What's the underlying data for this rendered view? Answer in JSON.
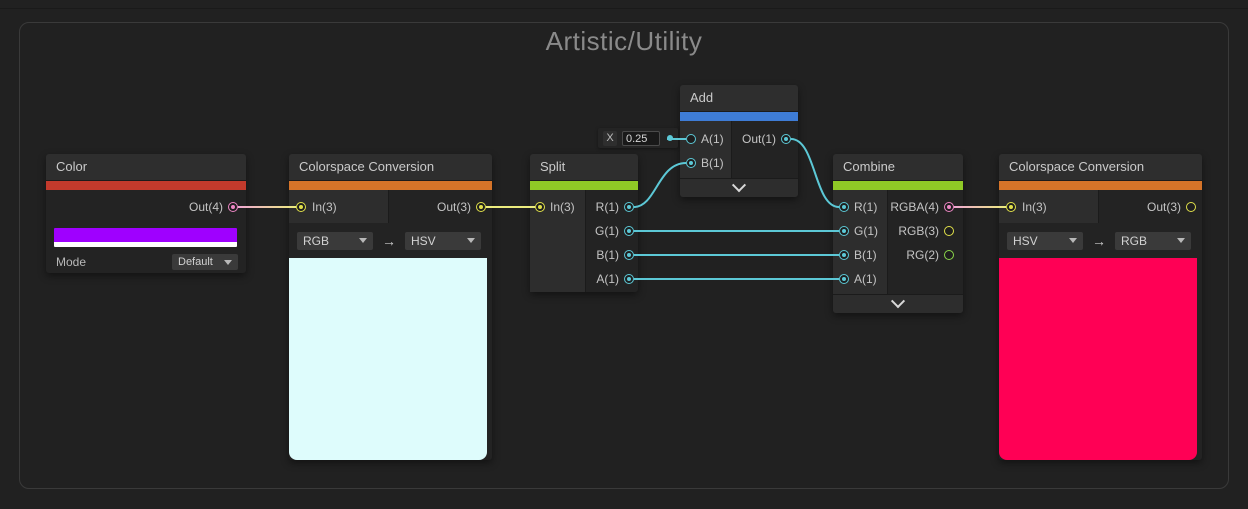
{
  "frame": {
    "title": "Artistic/Utility"
  },
  "colors": {
    "canvas_bg": "#212121",
    "accent_red": "#c23a2c",
    "accent_orange": "#d57429",
    "accent_green": "#8fc926",
    "accent_blue": "#3e7cd6",
    "port_float": "#5cc8d6",
    "port_vector2": "#8bd64a",
    "port_vector3": "#e0e04a",
    "port_vector4": "#ed86c4",
    "wire_float": "#5cc8d6",
    "wire_vector3": "#ecec7e",
    "swatch_color": "#9f00ff",
    "preview_left": "#defcfc",
    "preview_right": "#ff0055"
  },
  "nodes": {
    "color": {
      "title": "Color",
      "out": "Out(4)",
      "mode_label": "Mode",
      "mode_value": "Default"
    },
    "colorspace_left": {
      "title": "Colorspace Conversion",
      "in": "In(3)",
      "out": "Out(3)",
      "from": "RGB",
      "to": "HSV",
      "arrow": "→"
    },
    "split": {
      "title": "Split",
      "in": "In(3)",
      "outputs": [
        "R(1)",
        "G(1)",
        "B(1)",
        "A(1)"
      ]
    },
    "add": {
      "title": "Add",
      "input_a": "A(1)",
      "input_b": "B(1)",
      "out": "Out(1)",
      "x_label": "X",
      "x_value": "0.25"
    },
    "combine": {
      "title": "Combine",
      "inputs": [
        "R(1)",
        "G(1)",
        "B(1)",
        "A(1)"
      ],
      "outputs": [
        "RGBA(4)",
        "RGB(3)",
        "RG(2)"
      ]
    },
    "colorspace_right": {
      "title": "Colorspace Conversion",
      "in": "In(3)",
      "out": "Out(3)",
      "from": "HSV",
      "to": "RGB",
      "arrow": "→"
    }
  }
}
